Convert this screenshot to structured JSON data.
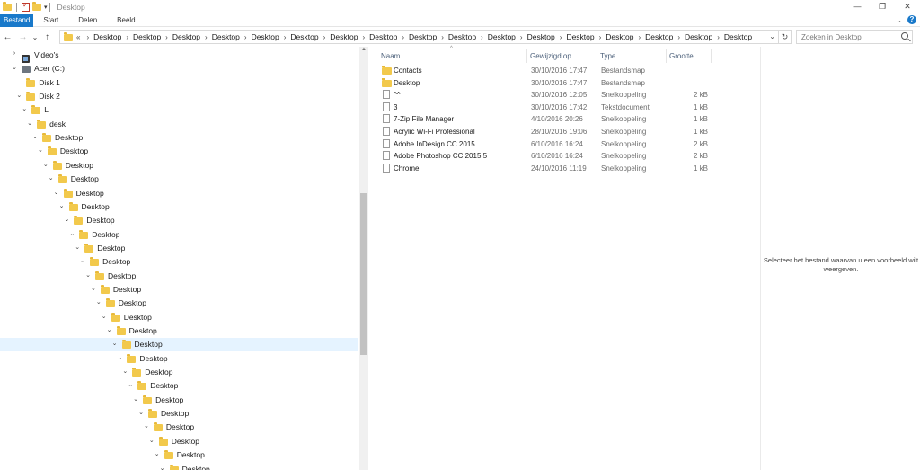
{
  "window": {
    "title": "Desktop",
    "controls": {
      "minimize": "—",
      "maximize": "❐",
      "close": "✕"
    }
  },
  "ribbon": {
    "tabs": [
      {
        "label": "Bestand",
        "active": true
      },
      {
        "label": "Start",
        "active": false
      },
      {
        "label": "Delen",
        "active": false
      },
      {
        "label": "Beeld",
        "active": false
      }
    ],
    "help": "?"
  },
  "navigation": {
    "back": "←",
    "forward": "→",
    "recent": "⌄",
    "up": "↑",
    "overflow": "«",
    "breadcrumbs": [
      "Desktop",
      "Desktop",
      "Desktop",
      "Desktop",
      "Desktop",
      "Desktop",
      "Desktop",
      "Desktop",
      "Desktop",
      "Desktop",
      "Desktop",
      "Desktop",
      "Desktop",
      "Desktop",
      "Desktop",
      "Desktop",
      "Desktop"
    ],
    "refresh": "↻",
    "search_placeholder": "Zoeken in Desktop"
  },
  "tree": [
    {
      "label": "Video's",
      "icon": "video-icon",
      "expanded": false,
      "depth": 0
    },
    {
      "label": "Acer (C:)",
      "icon": "drive-icon",
      "expanded": true,
      "depth": 0
    },
    {
      "label": "Disk 1",
      "icon": "folder-icon",
      "expanded": null,
      "depth": 1
    },
    {
      "label": "Disk 2",
      "icon": "folder-icon",
      "expanded": true,
      "depth": 1
    },
    {
      "label": "L",
      "icon": "folder-icon",
      "expanded": true,
      "depth": 2
    },
    {
      "label": "desk",
      "icon": "folder-icon",
      "expanded": true,
      "depth": 3
    },
    {
      "label": "Desktop",
      "icon": "folder-icon",
      "expanded": true,
      "depth": 4
    },
    {
      "label": "Desktop",
      "icon": "folder-icon",
      "expanded": true,
      "depth": 5
    },
    {
      "label": "Desktop",
      "icon": "folder-icon",
      "expanded": true,
      "depth": 6
    },
    {
      "label": "Desktop",
      "icon": "folder-icon",
      "expanded": true,
      "depth": 7
    },
    {
      "label": "Desktop",
      "icon": "folder-icon",
      "expanded": true,
      "depth": 8
    },
    {
      "label": "Desktop",
      "icon": "folder-icon",
      "expanded": true,
      "depth": 9
    },
    {
      "label": "Desktop",
      "icon": "folder-icon",
      "expanded": true,
      "depth": 10
    },
    {
      "label": "Desktop",
      "icon": "folder-icon",
      "expanded": true,
      "depth": 11
    },
    {
      "label": "Desktop",
      "icon": "folder-icon",
      "expanded": true,
      "depth": 12
    },
    {
      "label": "Desktop",
      "icon": "folder-icon",
      "expanded": true,
      "depth": 13
    },
    {
      "label": "Desktop",
      "icon": "folder-icon",
      "expanded": true,
      "depth": 14
    },
    {
      "label": "Desktop",
      "icon": "folder-icon",
      "expanded": true,
      "depth": 15
    },
    {
      "label": "Desktop",
      "icon": "folder-icon",
      "expanded": true,
      "depth": 16
    },
    {
      "label": "Desktop",
      "icon": "folder-icon",
      "expanded": true,
      "depth": 17
    },
    {
      "label": "Desktop",
      "icon": "folder-icon",
      "expanded": true,
      "depth": 18
    },
    {
      "label": "Desktop",
      "icon": "folder-icon",
      "expanded": true,
      "depth": 19,
      "selected": true
    },
    {
      "label": "Desktop",
      "icon": "folder-icon",
      "expanded": true,
      "depth": 20
    },
    {
      "label": "Desktop",
      "icon": "folder-icon",
      "expanded": true,
      "depth": 21
    },
    {
      "label": "Desktop",
      "icon": "folder-icon",
      "expanded": true,
      "depth": 22
    },
    {
      "label": "Desktop",
      "icon": "folder-icon",
      "expanded": true,
      "depth": 23
    },
    {
      "label": "Desktop",
      "icon": "folder-icon",
      "expanded": true,
      "depth": 24
    },
    {
      "label": "Desktop",
      "icon": "folder-icon",
      "expanded": true,
      "depth": 25
    },
    {
      "label": "Desktop",
      "icon": "folder-icon",
      "expanded": true,
      "depth": 26
    },
    {
      "label": "Desktop",
      "icon": "folder-icon",
      "expanded": true,
      "depth": 27
    },
    {
      "label": "Desktop",
      "icon": "folder-icon",
      "expanded": true,
      "depth": 28
    }
  ],
  "columns": [
    {
      "label": "Naam"
    },
    {
      "label": "Gewijzigd op"
    },
    {
      "label": "Type"
    },
    {
      "label": "Grootte"
    }
  ],
  "files": [
    {
      "name": "Contacts",
      "modified": "30/10/2016 17:47",
      "type": "Bestandsmap",
      "size": "",
      "icon": "folder-icon"
    },
    {
      "name": "Desktop",
      "modified": "30/10/2016 17:47",
      "type": "Bestandsmap",
      "size": "",
      "icon": "folder-icon"
    },
    {
      "name": "^^",
      "modified": "30/10/2016 12:05",
      "type": "Snelkoppeling",
      "size": "2 kB",
      "icon": "file-icon"
    },
    {
      "name": "3",
      "modified": "30/10/2016 17:42",
      "type": "Tekstdocument",
      "size": "1 kB",
      "icon": "file-icon"
    },
    {
      "name": "7-Zip File Manager",
      "modified": "4/10/2016 20:26",
      "type": "Snelkoppeling",
      "size": "1 kB",
      "icon": "file-icon"
    },
    {
      "name": "Acrylic Wi-Fi Professional",
      "modified": "28/10/2016 19:06",
      "type": "Snelkoppeling",
      "size": "1 kB",
      "icon": "file-icon"
    },
    {
      "name": "Adobe InDesign CC 2015",
      "modified": "6/10/2016 16:24",
      "type": "Snelkoppeling",
      "size": "2 kB",
      "icon": "file-icon"
    },
    {
      "name": "Adobe Photoshop CC 2015.5",
      "modified": "6/10/2016 16:24",
      "type": "Snelkoppeling",
      "size": "2 kB",
      "icon": "file-icon"
    },
    {
      "name": "Chrome",
      "modified": "24/10/2016 11:19",
      "type": "Snelkoppeling",
      "size": "1 kB",
      "icon": "file-icon"
    }
  ],
  "preview": {
    "line1": "Selecteer het bestand waarvan u een voorbeeld wilt",
    "line2": "weergeven."
  },
  "colors": {
    "accent": "#1979ca",
    "selection": "#e5f3ff",
    "folder": "#f2c94c",
    "header_text": "#4c607a"
  }
}
